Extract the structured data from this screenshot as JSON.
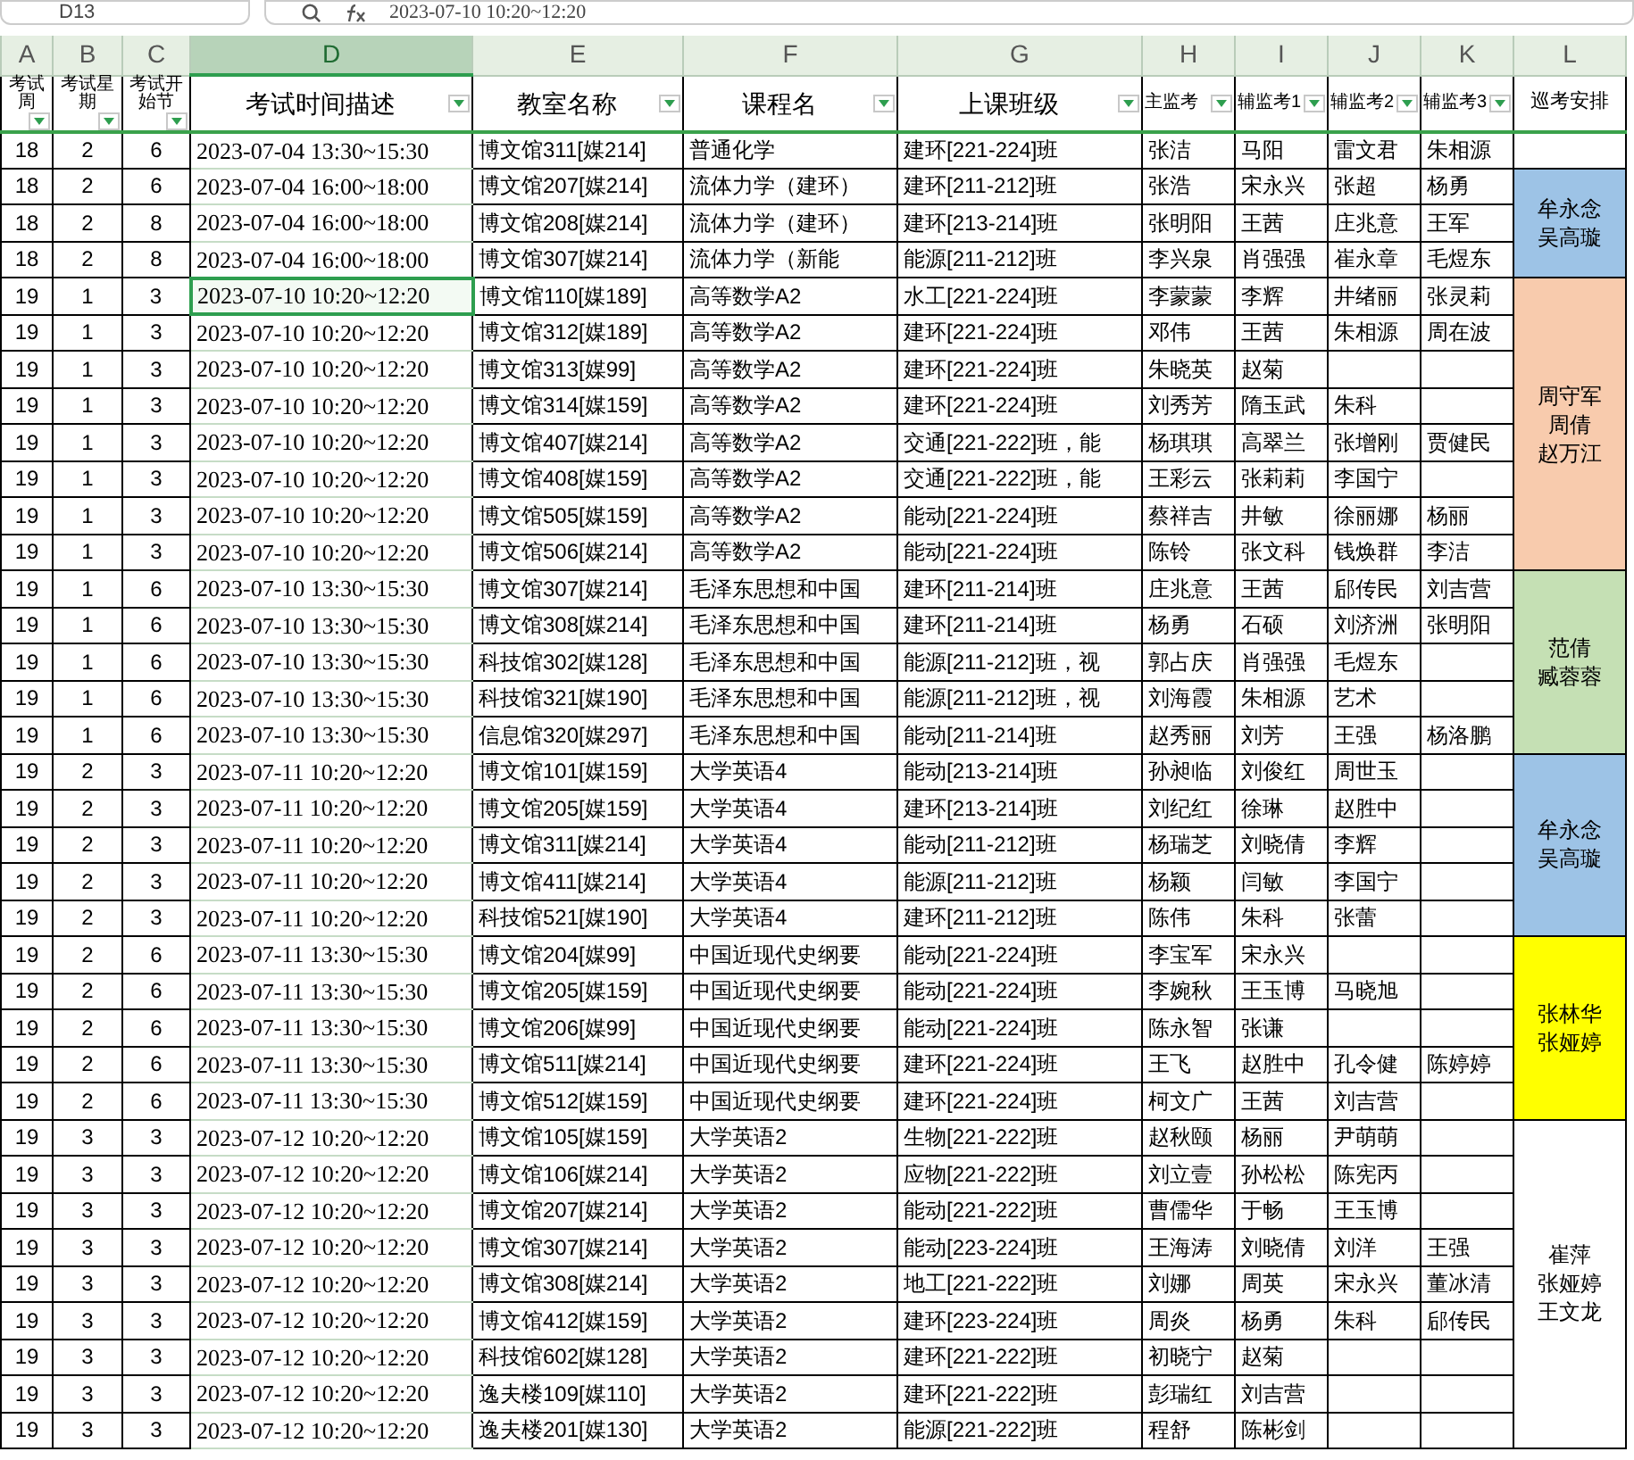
{
  "formula_bar": {
    "name_box": "D13",
    "formula": "2023-07-10 10:20~12:20"
  },
  "column_letters": [
    {
      "label": "A",
      "selected": false
    },
    {
      "label": "B",
      "selected": false
    },
    {
      "label": "C",
      "selected": false
    },
    {
      "label": "D",
      "selected": true
    },
    {
      "label": "E",
      "selected": false
    },
    {
      "label": "F",
      "selected": false
    },
    {
      "label": "G",
      "selected": false
    },
    {
      "label": "H",
      "selected": false
    },
    {
      "label": "I",
      "selected": false
    },
    {
      "label": "J",
      "selected": false
    },
    {
      "label": "K",
      "selected": false
    },
    {
      "label": "L",
      "selected": false
    }
  ],
  "headers": [
    {
      "label": "考试周",
      "filter": true
    },
    {
      "label": "考试星期",
      "filter": true
    },
    {
      "label": "考试开始节",
      "filter": true
    },
    {
      "label": "考试时间描述",
      "filter": true
    },
    {
      "label": "教室名称",
      "filter": true
    },
    {
      "label": "课程名",
      "filter": true
    },
    {
      "label": "上课班级",
      "filter": true
    },
    {
      "label": "主监考",
      "filter": true
    },
    {
      "label": "辅监考1",
      "filter": true
    },
    {
      "label": "辅监考2",
      "filter": true
    },
    {
      "label": "辅监考3",
      "filter": true
    },
    {
      "label": "巡考安排",
      "filter": false
    }
  ],
  "groups": [
    {
      "rows": [
        {
          "selected": false,
          "week": "18",
          "day": "2",
          "period": "6",
          "time": "2023-07-04 13:30~15:30",
          "room": "博文馆311[媒214]",
          "course": "普通化学",
          "class": "建环[221-224]班",
          "chief": "张洁",
          "assist_1": "马阳",
          "assist_2": "雷文君",
          "assist_3": "朱相源"
        }
      ]
    },
    {
      "patrol": {
        "lines": [
          "牟永念",
          "吴高璇"
        ],
        "color": "#9dc3e6"
      },
      "rows": [
        {
          "selected": false,
          "week": "18",
          "day": "2",
          "period": "6",
          "time": "2023-07-04 16:00~18:00",
          "room": "博文馆207[媒214]",
          "course": "流体力学（建环）",
          "class": "建环[211-212]班",
          "chief": "张浩",
          "assist_1": "宋永兴",
          "assist_2": "张超",
          "assist_3": "杨勇"
        },
        {
          "selected": false,
          "week": "18",
          "day": "2",
          "period": "8",
          "time": "2023-07-04 16:00~18:00",
          "room": "博文馆208[媒214]",
          "course": "流体力学（建环）",
          "class": "建环[213-214]班",
          "chief": "张明阳",
          "assist_1": "王茜",
          "assist_2": "庄兆意",
          "assist_3": "王军"
        },
        {
          "selected": false,
          "week": "18",
          "day": "2",
          "period": "8",
          "time": "2023-07-04 16:00~18:00",
          "room": "博文馆307[媒214]",
          "course": "流体力学（新能",
          "class": "能源[211-212]班",
          "chief": "李兴泉",
          "assist_1": "肖强强",
          "assist_2": "崔永章",
          "assist_3": "毛煜东"
        }
      ]
    },
    {
      "patrol": {
        "lines": [
          "周守军",
          "周倩",
          "赵万江"
        ],
        "color": "#f8cbad"
      },
      "rows": [
        {
          "selected": true,
          "week": "19",
          "day": "1",
          "period": "3",
          "time": "2023-07-10 10:20~12:20",
          "room": "博文馆110[媒189]",
          "course": "高等数学A2",
          "class": "水工[221-224]班",
          "chief": "李蒙蒙",
          "assist_1": "李辉",
          "assist_2": "井绪丽",
          "assist_3": "张灵莉"
        },
        {
          "selected": false,
          "week": "19",
          "day": "1",
          "period": "3",
          "time": "2023-07-10 10:20~12:20",
          "room": "博文馆312[媒189]",
          "course": "高等数学A2",
          "class": "建环[221-224]班",
          "chief": "邓伟",
          "assist_1": "王茜",
          "assist_2": "朱相源",
          "assist_3": "周在波"
        },
        {
          "selected": false,
          "week": "19",
          "day": "1",
          "period": "3",
          "time": "2023-07-10 10:20~12:20",
          "room": "博文馆313[媒99]",
          "course": "高等数学A2",
          "class": "建环[221-224]班",
          "chief": "朱晓英",
          "assist_1": "赵菊"
        },
        {
          "selected": false,
          "week": "19",
          "day": "1",
          "period": "3",
          "time": "2023-07-10 10:20~12:20",
          "room": "博文馆314[媒159]",
          "course": "高等数学A2",
          "class": "建环[221-224]班",
          "chief": "刘秀芳",
          "assist_1": "隋玉武",
          "assist_2": "朱科"
        },
        {
          "selected": false,
          "week": "19",
          "day": "1",
          "period": "3",
          "time": "2023-07-10 10:20~12:20",
          "room": "博文馆407[媒214]",
          "course": "高等数学A2",
          "class": "交通[221-222]班，能",
          "chief": "杨琪琪",
          "assist_1": "高翠兰",
          "assist_2": "张增刚",
          "assist_3": "贾健民"
        },
        {
          "selected": false,
          "week": "19",
          "day": "1",
          "period": "3",
          "time": "2023-07-10 10:20~12:20",
          "room": "博文馆408[媒159]",
          "course": "高等数学A2",
          "class": "交通[221-222]班，能",
          "chief": "王彩云",
          "assist_1": "张莉莉",
          "assist_2": "李国宁"
        },
        {
          "selected": false,
          "week": "19",
          "day": "1",
          "period": "3",
          "time": "2023-07-10 10:20~12:20",
          "room": "博文馆505[媒159]",
          "course": "高等数学A2",
          "class": "能动[221-224]班",
          "chief": "蔡祥吉",
          "assist_1": "井敏",
          "assist_2": "徐丽娜",
          "assist_3": "杨丽"
        },
        {
          "selected": false,
          "week": "19",
          "day": "1",
          "period": "3",
          "time": "2023-07-10 10:20~12:20",
          "room": "博文馆506[媒214]",
          "course": "高等数学A2",
          "class": "能动[221-224]班",
          "chief": "陈铃",
          "assist_1": "张文科",
          "assist_2": "钱焕群",
          "assist_3": "李洁"
        }
      ]
    },
    {
      "patrol": {
        "lines": [
          "范倩",
          "臧蓉蓉"
        ],
        "color": "#c5e0b4"
      },
      "rows": [
        {
          "selected": false,
          "week": "19",
          "day": "1",
          "period": "6",
          "time": "2023-07-10 13:30~15:30",
          "room": "博文馆307[媒214]",
          "course": "毛泽东思想和中国",
          "class": "建环[211-214]班",
          "chief": "庄兆意",
          "assist_1": "王茜",
          "assist_2": "郈传民",
          "assist_3": "刘吉营"
        },
        {
          "selected": false,
          "week": "19",
          "day": "1",
          "period": "6",
          "time": "2023-07-10 13:30~15:30",
          "room": "博文馆308[媒214]",
          "course": "毛泽东思想和中国",
          "class": "建环[211-214]班",
          "chief": "杨勇",
          "assist_1": "石硕",
          "assist_2": "刘济洲",
          "assist_3": "张明阳"
        },
        {
          "selected": false,
          "week": "19",
          "day": "1",
          "period": "6",
          "time": "2023-07-10 13:30~15:30",
          "room": "科技馆302[媒128]",
          "course": "毛泽东思想和中国",
          "class": "能源[211-212]班，视",
          "chief": "郭占庆",
          "assist_1": "肖强强",
          "assist_2": "毛煜东"
        },
        {
          "selected": false,
          "week": "19",
          "day": "1",
          "period": "6",
          "time": "2023-07-10 13:30~15:30",
          "room": "科技馆321[媒190]",
          "course": "毛泽东思想和中国",
          "class": "能源[211-212]班，视",
          "chief": "刘海霞",
          "assist_1": "朱相源",
          "assist_2": "艺术"
        },
        {
          "selected": false,
          "week": "19",
          "day": "1",
          "period": "6",
          "time": "2023-07-10 13:30~15:30",
          "room": "信息馆320[媒297]",
          "course": "毛泽东思想和中国",
          "class": "能动[211-214]班",
          "chief": "赵秀丽",
          "assist_1": "刘芳",
          "assist_2": "王强",
          "assist_3": "杨洛鹏"
        }
      ]
    },
    {
      "patrol": {
        "lines": [
          "牟永念",
          "吴高璇"
        ],
        "color": "#9dc3e6"
      },
      "rows": [
        {
          "selected": false,
          "week": "19",
          "day": "2",
          "period": "3",
          "time": "2023-07-11 10:20~12:20",
          "room": "博文馆101[媒159]",
          "course": "大学英语4",
          "class": "能动[213-214]班",
          "chief": "孙昶临",
          "assist_1": "刘俊红",
          "assist_2": "周世玉"
        },
        {
          "selected": false,
          "week": "19",
          "day": "2",
          "period": "3",
          "time": "2023-07-11 10:20~12:20",
          "room": "博文馆205[媒159]",
          "course": "大学英语4",
          "class": "建环[213-214]班",
          "chief": "刘纪红",
          "assist_1": "徐琳",
          "assist_2": "赵胜中"
        },
        {
          "selected": false,
          "week": "19",
          "day": "2",
          "period": "3",
          "time": "2023-07-11 10:20~12:20",
          "room": "博文馆311[媒214]",
          "course": "大学英语4",
          "class": "能动[211-212]班",
          "chief": "杨瑞芝",
          "assist_1": "刘晓倩",
          "assist_2": "李辉"
        },
        {
          "selected": false,
          "week": "19",
          "day": "2",
          "period": "3",
          "time": "2023-07-11 10:20~12:20",
          "room": "博文馆411[媒214]",
          "course": "大学英语4",
          "class": "能源[211-212]班",
          "chief": "杨颖",
          "assist_1": "闫敏",
          "assist_2": "李国宁"
        },
        {
          "selected": false,
          "week": "19",
          "day": "2",
          "period": "3",
          "time": "2023-07-11 10:20~12:20",
          "room": "科技馆521[媒190]",
          "course": "大学英语4",
          "class": "建环[211-212]班",
          "chief": "陈伟",
          "assist_1": "朱科",
          "assist_2": "张蕾"
        }
      ]
    },
    {
      "patrol": {
        "lines": [
          "张林华",
          "张娅婷"
        ],
        "color": "#ffff00"
      },
      "rows": [
        {
          "selected": false,
          "week": "19",
          "day": "2",
          "period": "6",
          "time": "2023-07-11 13:30~15:30",
          "room": "博文馆204[媒99]",
          "course": "中国近现代史纲要",
          "class": "能动[221-224]班",
          "chief": "李宝军",
          "assist_1": "宋永兴"
        },
        {
          "selected": false,
          "week": "19",
          "day": "2",
          "period": "6",
          "time": "2023-07-11 13:30~15:30",
          "room": "博文馆205[媒159]",
          "course": "中国近现代史纲要",
          "class": "能动[221-224]班",
          "chief": "李婉秋",
          "assist_1": "王玉博",
          "assist_2": "马晓旭"
        },
        {
          "selected": false,
          "week": "19",
          "day": "2",
          "period": "6",
          "time": "2023-07-11 13:30~15:30",
          "room": "博文馆206[媒99]",
          "course": "中国近现代史纲要",
          "class": "能动[221-224]班",
          "chief": "陈永智",
          "assist_1": "张谦"
        },
        {
          "selected": false,
          "week": "19",
          "day": "2",
          "period": "6",
          "time": "2023-07-11 13:30~15:30",
          "room": "博文馆511[媒214]",
          "course": "中国近现代史纲要",
          "class": "建环[221-224]班",
          "chief": "王飞",
          "assist_1": "赵胜中",
          "assist_2": "孔令健",
          "assist_3": "陈婷婷"
        },
        {
          "selected": false,
          "week": "19",
          "day": "2",
          "period": "6",
          "time": "2023-07-11 13:30~15:30",
          "room": "博文馆512[媒159]",
          "course": "中国近现代史纲要",
          "class": "建环[221-224]班",
          "chief": "柯文广",
          "assist_1": "王茜",
          "assist_2": "刘吉营"
        }
      ]
    },
    {
      "patrol": {
        "lines": [
          "崔萍",
          "张娅婷",
          "王文龙"
        ],
        "color": "#ffffff"
      },
      "rows": [
        {
          "selected": false,
          "week": "19",
          "day": "3",
          "period": "3",
          "time": "2023-07-12 10:20~12:20",
          "room": "博文馆105[媒159]",
          "course": "大学英语2",
          "class": "生物[221-222]班",
          "chief": "赵秋颐",
          "assist_1": "杨丽",
          "assist_2": "尹萌萌"
        },
        {
          "selected": false,
          "week": "19",
          "day": "3",
          "period": "3",
          "time": "2023-07-12 10:20~12:20",
          "room": "博文馆106[媒214]",
          "course": "大学英语2",
          "class": "应物[221-222]班",
          "chief": "刘立壹",
          "assist_1": "孙松松",
          "assist_2": "陈宪丙"
        },
        {
          "selected": false,
          "week": "19",
          "day": "3",
          "period": "3",
          "time": "2023-07-12 10:20~12:20",
          "room": "博文馆207[媒214]",
          "course": "大学英语2",
          "class": "能动[221-222]班",
          "chief": "曹儒华",
          "assist_1": "于畅",
          "assist_2": "王玉博"
        },
        {
          "selected": false,
          "week": "19",
          "day": "3",
          "period": "3",
          "time": "2023-07-12 10:20~12:20",
          "room": "博文馆307[媒214]",
          "course": "大学英语2",
          "class": "能动[223-224]班",
          "chief": "王海涛",
          "assist_1": "刘晓倩",
          "assist_2": "刘洋",
          "assist_3": "王强"
        },
        {
          "selected": false,
          "week": "19",
          "day": "3",
          "period": "3",
          "time": "2023-07-12 10:20~12:20",
          "room": "博文馆308[媒214]",
          "course": "大学英语2",
          "class": "地工[221-222]班",
          "chief": "刘娜",
          "assist_1": "周英",
          "assist_2": "宋永兴",
          "assist_3": "董冰清"
        },
        {
          "selected": false,
          "week": "19",
          "day": "3",
          "period": "3",
          "time": "2023-07-12 10:20~12:20",
          "room": "博文馆412[媒159]",
          "course": "大学英语2",
          "class": "建环[223-224]班",
          "chief": "周炎",
          "assist_1": "杨勇",
          "assist_2": "朱科",
          "assist_3": "郈传民"
        },
        {
          "selected": false,
          "week": "19",
          "day": "3",
          "period": "3",
          "time": "2023-07-12 10:20~12:20",
          "room": "科技馆602[媒128]",
          "course": "大学英语2",
          "class": "建环[221-222]班",
          "chief": "初晓宁",
          "assist_1": "赵菊"
        },
        {
          "selected": false,
          "week": "19",
          "day": "3",
          "period": "3",
          "time": "2023-07-12 10:20~12:20",
          "room": "逸夫楼109[媒110]",
          "course": "大学英语2",
          "class": "建环[221-222]班",
          "chief": "彭瑞红",
          "assist_1": "刘吉营"
        },
        {
          "selected": false,
          "week": "19",
          "day": "3",
          "period": "3",
          "time": "2023-07-12 10:20~12:20",
          "room": "逸夫楼201[媒130]",
          "course": "大学英语2",
          "class": "能源[221-222]班",
          "chief": "程舒",
          "assist_1": "陈彬剑"
        }
      ]
    }
  ]
}
